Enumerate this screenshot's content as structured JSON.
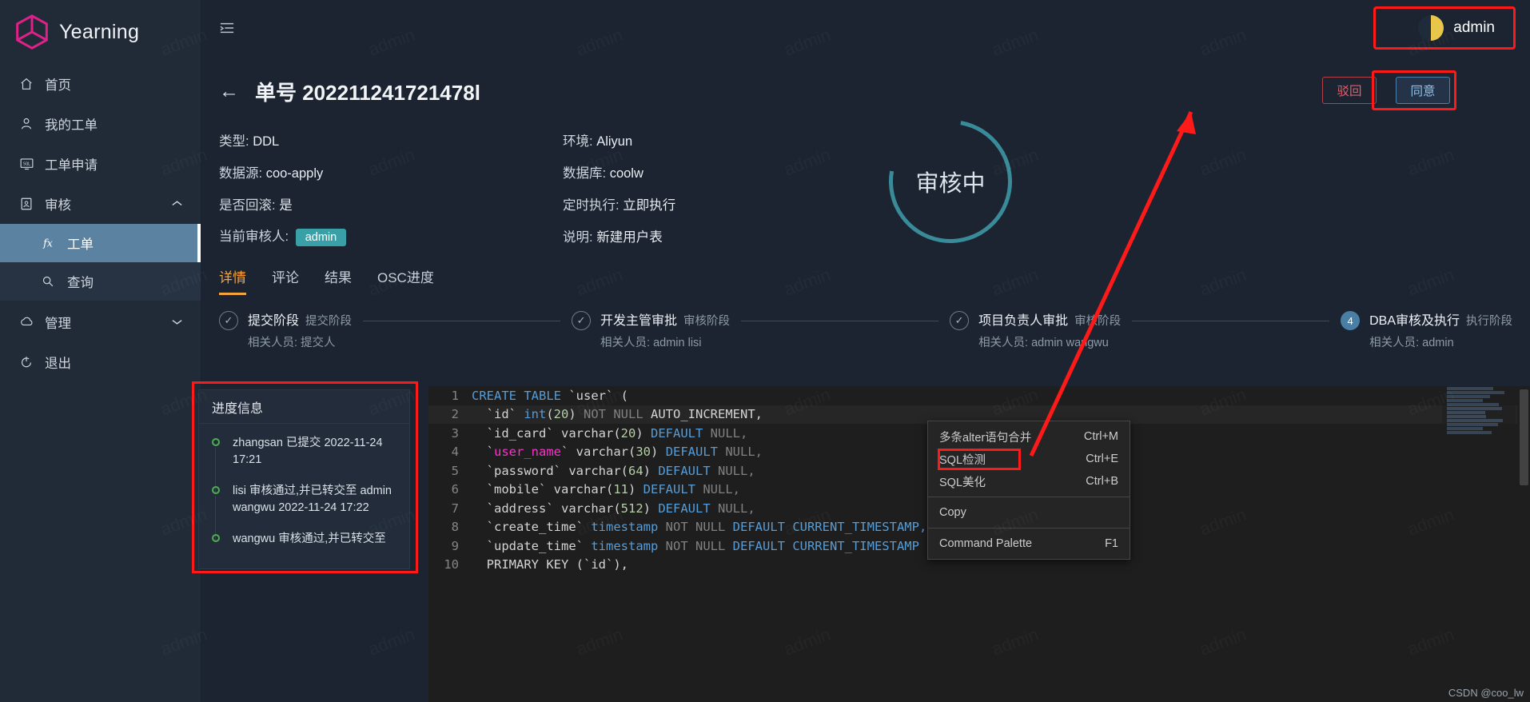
{
  "brand": {
    "name": "Yearning"
  },
  "sidebar": {
    "items": [
      {
        "label": "首页",
        "icon": "home-icon"
      },
      {
        "label": "我的工单",
        "icon": "user-icon"
      },
      {
        "label": "工单申请",
        "icon": "sql-icon"
      },
      {
        "label": "审核",
        "icon": "audit-icon",
        "arrow": "⌃"
      },
      {
        "label": "管理",
        "icon": "cloud-icon",
        "arrow": "⌄"
      },
      {
        "label": "退出",
        "icon": "logout-icon"
      }
    ],
    "sub": [
      {
        "label": "工单",
        "icon": "fx-icon",
        "active": true
      },
      {
        "label": "查询",
        "icon": "search-icon",
        "active": false
      }
    ]
  },
  "topbar": {
    "collapse_icon": "collapse-menu-icon",
    "user": "admin"
  },
  "page": {
    "back_icon": "back-arrow-icon",
    "title": "单号 202211241721478l",
    "title_text": "单号 202211241721478",
    "reject_label": "驳回",
    "approve_label": "同意",
    "status": "审核中"
  },
  "meta": {
    "rows": [
      {
        "left_label": "类型:",
        "left_value": "DDL",
        "right_label": "环境:",
        "right_value": "Aliyun"
      },
      {
        "left_label": "数据源:",
        "left_value": "coo-apply",
        "right_label": "数据库:",
        "right_value": "coolw"
      },
      {
        "left_label": "是否回滚:",
        "left_value": "是",
        "right_label": "定时执行:",
        "right_value": "立即执行"
      },
      {
        "left_label": "当前审核人:",
        "left_value": "admin",
        "right_label": "说明:",
        "right_value": "新建用户表"
      }
    ],
    "reviewer_badge": "admin"
  },
  "tabs": [
    {
      "label": "详情",
      "active": true
    },
    {
      "label": "评论",
      "active": false
    },
    {
      "label": "结果",
      "active": false
    },
    {
      "label": "OSC进度",
      "active": false
    }
  ],
  "steps": [
    {
      "num": "✓",
      "title": "提交阶段",
      "sub": "提交阶段",
      "people": "相关人员: 提交人",
      "filled": false
    },
    {
      "num": "✓",
      "title": "开发主管审批",
      "sub": "审核阶段",
      "people": "相关人员: admin lisi",
      "filled": false
    },
    {
      "num": "✓",
      "title": "项目负责人审批",
      "sub": "审核阶段",
      "people": "相关人员: admin wangwu",
      "filled": false
    },
    {
      "num": "4",
      "title": "DBA审核及执行",
      "sub": "执行阶段",
      "people": "相关人员: admin",
      "filled": true
    }
  ],
  "progress_panel": {
    "title": "进度信息",
    "items": [
      "zhangsan 已提交 2022-11-24 17:21",
      "lisi 审核通过,并已转交至 admin wangwu 2022-11-24 17:22",
      "wangwu 审核通过,并已转交至"
    ]
  },
  "editor": {
    "lines": [
      {
        "n": "1",
        "tokens": [
          {
            "t": "CREATE TABLE ",
            "c": "k"
          },
          {
            "t": "`user`",
            "c": "wt"
          },
          {
            "t": " (",
            "c": "wt"
          }
        ]
      },
      {
        "n": "2",
        "cur": true,
        "tokens": [
          {
            "t": "  ",
            "c": "wt"
          },
          {
            "t": "`id`",
            "c": "wt"
          },
          {
            "t": " int",
            "c": "k"
          },
          {
            "t": "(",
            "c": "wt"
          },
          {
            "t": "20",
            "c": "nm"
          },
          {
            "t": ") ",
            "c": "wt"
          },
          {
            "t": "NOT NULL",
            "c": "gr"
          },
          {
            "t": " AUTO_INCREMENT,",
            "c": "wt"
          }
        ]
      },
      {
        "n": "3",
        "tokens": [
          {
            "t": "  ",
            "c": "wt"
          },
          {
            "t": "`id_card`",
            "c": "wt"
          },
          {
            "t": " varchar",
            "c": "wt"
          },
          {
            "t": "(",
            "c": "wt"
          },
          {
            "t": "20",
            "c": "nm"
          },
          {
            "t": ") ",
            "c": "wt"
          },
          {
            "t": "DEFAULT",
            "c": "k"
          },
          {
            "t": " NULL,",
            "c": "gr"
          }
        ]
      },
      {
        "n": "4",
        "tokens": [
          {
            "t": "  `",
            "c": "wt"
          },
          {
            "t": "user_name",
            "c": "mg"
          },
          {
            "t": "`",
            "c": "wt"
          },
          {
            "t": " varchar",
            "c": "wt"
          },
          {
            "t": "(",
            "c": "wt"
          },
          {
            "t": "30",
            "c": "nm"
          },
          {
            "t": ") ",
            "c": "wt"
          },
          {
            "t": "DEFAULT",
            "c": "k"
          },
          {
            "t": " NULL,",
            "c": "gr"
          }
        ]
      },
      {
        "n": "5",
        "tokens": [
          {
            "t": "  ",
            "c": "wt"
          },
          {
            "t": "`password`",
            "c": "wt"
          },
          {
            "t": " varchar",
            "c": "wt"
          },
          {
            "t": "(",
            "c": "wt"
          },
          {
            "t": "64",
            "c": "nm"
          },
          {
            "t": ") ",
            "c": "wt"
          },
          {
            "t": "DEFAULT",
            "c": "k"
          },
          {
            "t": " NULL,",
            "c": "gr"
          }
        ]
      },
      {
        "n": "6",
        "tokens": [
          {
            "t": "  ",
            "c": "wt"
          },
          {
            "t": "`mobile`",
            "c": "wt"
          },
          {
            "t": " varchar",
            "c": "wt"
          },
          {
            "t": "(",
            "c": "wt"
          },
          {
            "t": "11",
            "c": "nm"
          },
          {
            "t": ") ",
            "c": "wt"
          },
          {
            "t": "DEFAULT",
            "c": "k"
          },
          {
            "t": " NULL,",
            "c": "gr"
          }
        ]
      },
      {
        "n": "7",
        "tokens": [
          {
            "t": "  ",
            "c": "wt"
          },
          {
            "t": "`address`",
            "c": "wt"
          },
          {
            "t": " varchar",
            "c": "wt"
          },
          {
            "t": "(",
            "c": "wt"
          },
          {
            "t": "512",
            "c": "nm"
          },
          {
            "t": ") ",
            "c": "wt"
          },
          {
            "t": "DEFAULT",
            "c": "k"
          },
          {
            "t": " NULL,",
            "c": "gr"
          }
        ]
      },
      {
        "n": "8",
        "tokens": [
          {
            "t": "  ",
            "c": "wt"
          },
          {
            "t": "`create_time`",
            "c": "wt"
          },
          {
            "t": " timestamp",
            "c": "k"
          },
          {
            "t": " NOT NULL ",
            "c": "gr"
          },
          {
            "t": "DEFAULT",
            "c": "k"
          },
          {
            "t": " CURRENT_TIMESTAMP,",
            "c": "k"
          }
        ]
      },
      {
        "n": "9",
        "tokens": [
          {
            "t": "  ",
            "c": "wt"
          },
          {
            "t": "`update_time`",
            "c": "wt"
          },
          {
            "t": " timestamp",
            "c": "k"
          },
          {
            "t": " NOT NULL ",
            "c": "gr"
          },
          {
            "t": "DEFAULT",
            "c": "k"
          },
          {
            "t": " CURRENT_TIMESTAMP ON",
            "c": "k"
          }
        ]
      },
      {
        "n": "10",
        "tokens": [
          {
            "t": "  PRIMARY KEY ",
            "c": "wt"
          },
          {
            "t": "(",
            "c": "wt"
          },
          {
            "t": "`id`",
            "c": "wt"
          },
          {
            "t": "),",
            "c": "wt"
          }
        ]
      }
    ]
  },
  "context_menu": {
    "items": [
      {
        "label": "多条alter语句合并",
        "shortcut": "Ctrl+M",
        "sep": false,
        "highlight": false
      },
      {
        "label": "SQL检测",
        "shortcut": "Ctrl+E",
        "sep": false,
        "highlight": true
      },
      {
        "label": "SQL美化",
        "shortcut": "Ctrl+B",
        "sep": true,
        "highlight": false
      },
      {
        "label": "Copy",
        "shortcut": "",
        "sep": true,
        "highlight": false
      },
      {
        "label": "Command Palette",
        "shortcut": "F1",
        "sep": false,
        "highlight": false
      }
    ]
  },
  "watermark": {
    "text": "admin"
  },
  "footer": {
    "credit": "CSDN @coo_lw"
  },
  "colors": {
    "accent_orange": "#f5a43a",
    "brand_pink": "#e0218a",
    "badge_teal": "#3aa0a8",
    "annotation_red": "#ff1a1a",
    "step_blue": "#4a7fa5",
    "sidebar_bg": "#212b38",
    "main_bg": "#1b2430",
    "editor_bg": "#1e1e1e"
  }
}
